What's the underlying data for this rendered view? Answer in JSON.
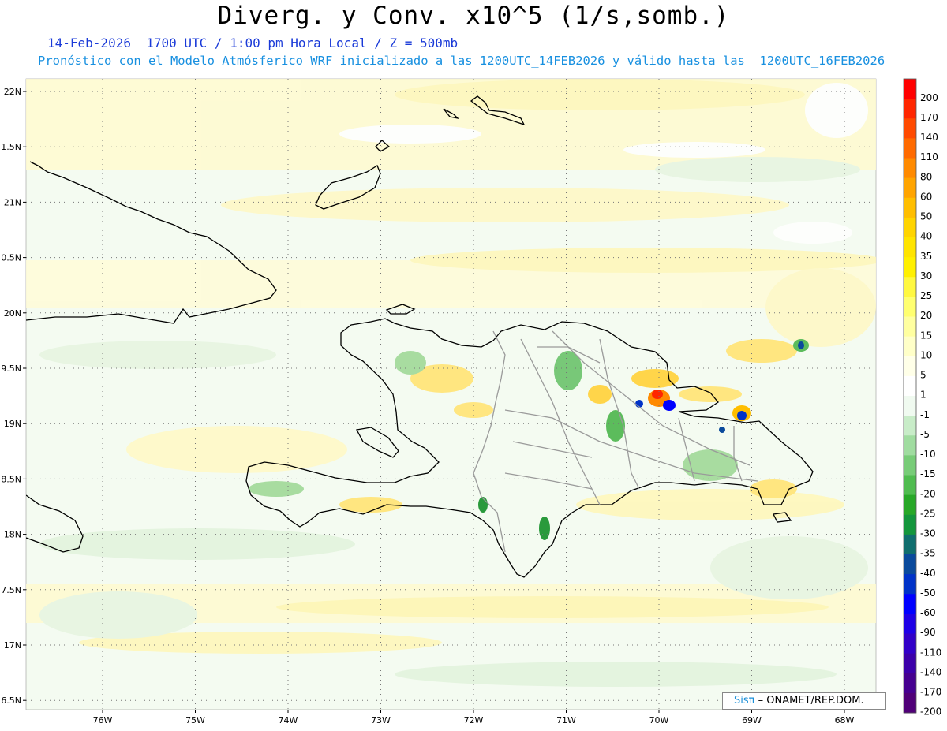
{
  "title": "Diverg. y Conv. x10^5 (1/s,somb.)",
  "subtitle_line1": "14-Feb-2026  1700 UTC / 1:00 pm Hora Local / Z = 500mb",
  "subtitle_line2": "Pronóstico con el Modelo Atmósferico WRF inicializado a las 1200UTC_14FEB2026 y válido hasta las  1200UTC_16FEB2026",
  "lat_labels": [
    "22N",
    "1.5N",
    "21N",
    "0.5N",
    "20N",
    "9.5N",
    "19N",
    "8.5N",
    "18N",
    "7.5N",
    "17N",
    "6.5N"
  ],
  "lon_labels": [
    "76W",
    "75W",
    "74W",
    "73W",
    "72W",
    "71W",
    "70W",
    "69W",
    "68W"
  ],
  "colorbar": {
    "labels": [
      "200",
      "170",
      "140",
      "110",
      "80",
      "60",
      "50",
      "40",
      "35",
      "30",
      "25",
      "20",
      "15",
      "10",
      "5",
      "1",
      "-1",
      "-5",
      "-10",
      "-15",
      "-20",
      "-25",
      "-30",
      "-35",
      "-40",
      "-50",
      "-60",
      "-90",
      "-110",
      "-140",
      "-170",
      "-200"
    ],
    "colors": [
      "#ff0000",
      "#ff2600",
      "#ff4a00",
      "#ff6a00",
      "#ff8a00",
      "#ffa400",
      "#ffbe00",
      "#ffd400",
      "#ffe400",
      "#fff000",
      "#fff840",
      "#ffff70",
      "#ffffa0",
      "#ffffc8",
      "#ffffe8",
      "#ffffff",
      "#f0faf0",
      "#c8ecc8",
      "#a0dca0",
      "#78cc78",
      "#50bc50",
      "#28a828",
      "#14963c",
      "#106e6e",
      "#0a4a9c",
      "#0032c8",
      "#0000ff",
      "#1e00e6",
      "#3200c8",
      "#3c00aa",
      "#460090",
      "#500078"
    ]
  },
  "credit_brand": "Sisπ",
  "credit_text": "– ONAMET/REP.DOM."
}
